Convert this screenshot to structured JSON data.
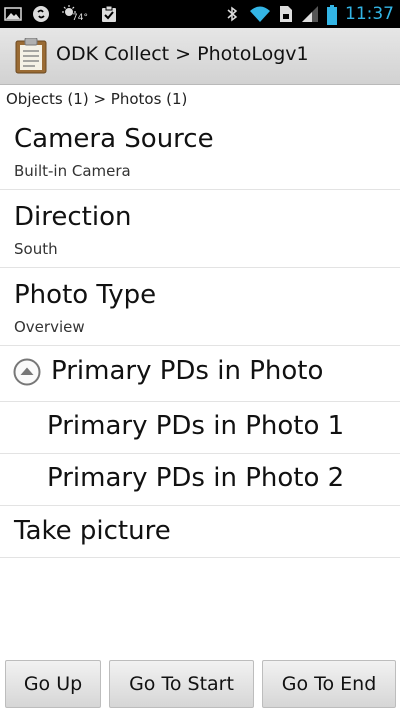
{
  "status_bar": {
    "temperature": "74°",
    "time": "11:37",
    "icons": [
      "gallery-icon",
      "shazam-icon",
      "weather-icon",
      "clipboard-check-icon",
      "bluetooth-icon",
      "wifi-icon",
      "sim-icon",
      "signal-icon",
      "battery-icon"
    ]
  },
  "titlebar": {
    "icon": "clipboard-icon",
    "title": "ODK Collect > PhotoLogv1"
  },
  "breadcrumb": "Objects (1) > Photos (1)",
  "prompts": {
    "camera_source": {
      "label": "Camera Source",
      "answer": "Built-in Camera"
    },
    "direction": {
      "label": "Direction",
      "answer": "South"
    },
    "photo_type": {
      "label": "Photo Type",
      "answer": "Overview"
    },
    "primary_pds_group": {
      "label": "Primary PDs in Photo",
      "icon": "collapse-up-icon"
    },
    "repeats": [
      {
        "label": "Primary PDs in Photo 1"
      },
      {
        "label": "Primary PDs in Photo 2"
      }
    ],
    "take_picture": {
      "label": "Take picture"
    }
  },
  "buttons": {
    "go_up": "Go Up",
    "go_to_start": "Go To Start",
    "go_to_end": "Go To End"
  },
  "colors": {
    "status_bar_bg": "#000000",
    "clock": "#33b5e5",
    "title_bar_bg": "#dcdcdc",
    "divider": "#e3e3e3"
  }
}
